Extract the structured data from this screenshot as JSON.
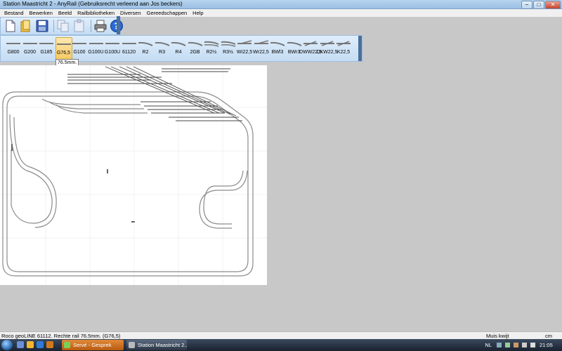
{
  "window": {
    "title": "Station Maastricht 2 - AnyRail (Gebruiksrecht verleend aan Jos beckers)",
    "controls": [
      "minimize",
      "maximize",
      "close"
    ]
  },
  "menu": [
    "Bestand",
    "Bewerken",
    "Beeld",
    "Railbibliotheken",
    "Diversen",
    "Gereedschappen",
    "Help"
  ],
  "toolbar": {
    "icons": [
      "new-file-icon",
      "open-folder-icon",
      "save-icon",
      "copy-icon",
      "paste-icon",
      "print-icon",
      "help-icon"
    ]
  },
  "parts": [
    {
      "label": "G800",
      "shape": "straight"
    },
    {
      "label": "G200",
      "shape": "straight"
    },
    {
      "label": "G185",
      "shape": "straight"
    },
    {
      "label": "G76,5",
      "shape": "straight",
      "selected": true
    },
    {
      "label": "G100",
      "shape": "straight"
    },
    {
      "label": "G100U",
      "shape": "straight"
    },
    {
      "label": "G100U",
      "shape": "straight"
    },
    {
      "label": "61120",
      "shape": "straight"
    },
    {
      "label": "R2",
      "shape": "curve"
    },
    {
      "label": "R3",
      "shape": "curve"
    },
    {
      "label": "R4",
      "shape": "curve"
    },
    {
      "label": "2GB",
      "shape": "curve"
    },
    {
      "label": "R2½",
      "shape": "double"
    },
    {
      "label": "R3½",
      "shape": "double"
    },
    {
      "label": "WI22,5",
      "shape": "switch"
    },
    {
      "label": "Wr22,5",
      "shape": "switch"
    },
    {
      "label": "BWl3",
      "shape": "curve"
    },
    {
      "label": "BWr3",
      "shape": "curve"
    },
    {
      "label": "DWW22,5",
      "shape": "cross"
    },
    {
      "label": "DKW22,5",
      "shape": "cross"
    },
    {
      "label": "K22,5",
      "shape": "cross"
    }
  ],
  "tooltip": "76.5mm.",
  "status": {
    "left": "Roco geoLINE 61112. Rechte rail 76.5mm. (G76,5)",
    "mouse": "Muis kwijt",
    "unit": "cm"
  },
  "taskbar": {
    "tasks": [
      "Servé - Gesprek",
      "Station Maastricht 2..."
    ],
    "tray_lang": "NL",
    "clock": "21:05"
  }
}
